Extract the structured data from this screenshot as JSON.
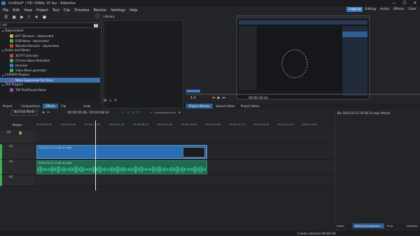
{
  "window": {
    "title": "Untitled* / HD 1080p 25 fps - Kdenlive",
    "min": "—",
    "max": "☐",
    "close": "✕"
  },
  "menu": [
    "File",
    "Edit",
    "View",
    "Project",
    "Tool",
    "Clip",
    "Timeline",
    "Monitor",
    "Settings",
    "Help"
  ],
  "layouts": [
    "Logging",
    "Editing",
    "Audio",
    "Effects",
    "Color"
  ],
  "effects_search": {
    "value": "noi",
    "clear": "✕"
  },
  "effects_tree": [
    {
      "type": "cat",
      "label": "Deprecated"
    },
    {
      "type": "item",
      "label": "DCT Denoiser - deprecated",
      "color": "#d9b13b"
    },
    {
      "type": "item",
      "label": "RGB Noise - deprecated",
      "color": "#3fae5a"
    },
    {
      "type": "item",
      "label": "Wavelet Denoiser - deprecated",
      "color": "#d53b3b"
    },
    {
      "type": "cat",
      "label": "Grain and Noise"
    },
    {
      "type": "item",
      "label": "3D FFT Denoiser",
      "color": "#d53b3b"
    },
    {
      "type": "item",
      "label": "Chroma Noise Reduction",
      "color": "#3fae5a"
    },
    {
      "type": "item",
      "label": "Denoiser",
      "color": "#3a7bd5"
    },
    {
      "type": "item",
      "label": "Video Noise generator",
      "color": "#3fae5a"
    },
    {
      "type": "cat",
      "label": "LADSPA Plugins"
    },
    {
      "type": "item",
      "label": "Noise Suppressor for Voice",
      "color": "#8c4fc1",
      "selected": true
    },
    {
      "type": "cat",
      "label": "TAP Plugins"
    },
    {
      "type": "item",
      "label": "TAP Pink/Fractal Noise",
      "color": "#8c4fc1"
    }
  ],
  "library": {
    "title": "Library"
  },
  "left_tabs": [
    "Project Bin",
    "Compositions",
    "Effects",
    "Clip Properties",
    "Undo History"
  ],
  "left_tabs_active": 2,
  "monitor": {
    "timecode": "00:00:18:14",
    "zoom": "1:1"
  },
  "monitor_tabs": [
    "Project Monitor",
    "Speech Editor",
    "Project Notes"
  ],
  "timeline": {
    "mode": "Normal Mode",
    "timecode": "00:00:05:09 / 00:00:08:14",
    "master": "Master",
    "ruler": [
      "00:00:00:00",
      "00:00:07:04",
      "00:00:14:09",
      "00:00:21:14",
      "00:00:28:19",
      "00:00:35:24",
      "00:00:43:04",
      "00:00:50:09",
      "00:00:57:14",
      "00:01:04:19",
      "00:01:11:24",
      "00:01:19:04"
    ],
    "tracks": [
      {
        "name": "V2",
        "kind": "video"
      },
      {
        "name": "V1",
        "kind": "video"
      },
      {
        "name": "A1",
        "kind": "audio"
      },
      {
        "name": "A2",
        "kind": "audio"
      }
    ],
    "video_clip": "2023-03-13 19-58-31.mp4",
    "audio_clip": "2023-03-13 19-58-31.mp4"
  },
  "right_panel": {
    "title": "Bin 2023-03-13 19-58-31.mp4 effects"
  },
  "right_tabs": [
    "Audio Mi...",
    "Effect/Composition...",
    "Time Rem...",
    "Subtitles"
  ],
  "right_tabs_active": 1,
  "status": "1 items selected (00:46:19)",
  "colors": {
    "accent": "#3d7ac9",
    "video_clip": "#2a6fb3",
    "audio_clip": "#1b6a50",
    "selection": "#3d6fa8"
  }
}
